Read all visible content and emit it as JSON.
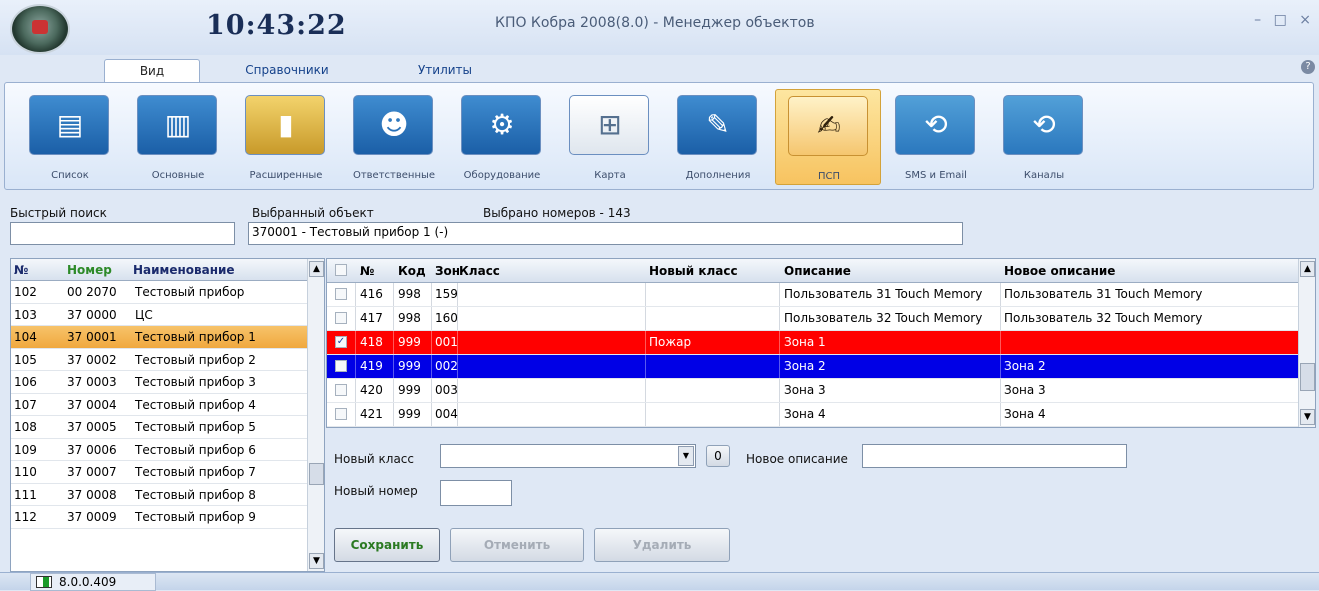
{
  "window": {
    "clock": "10:43:22",
    "title": "КПО Кобра 2008(8.0) -   Менеджер объектов",
    "controls": [
      "–",
      "□",
      "×"
    ]
  },
  "tabs": [
    {
      "label": "Вид",
      "active": true
    },
    {
      "label": "Справочники",
      "active": false
    },
    {
      "label": "Утилиты",
      "active": false
    }
  ],
  "ribbon": [
    {
      "label": "Список",
      "icon": "list-icon"
    },
    {
      "label": "Основные",
      "icon": "window-icon"
    },
    {
      "label": "Расширенные",
      "icon": "book-icon"
    },
    {
      "label": "Ответственные",
      "icon": "users-icon"
    },
    {
      "label": "Оборудование",
      "icon": "equipment-icon"
    },
    {
      "label": "Карта",
      "icon": "map-icon"
    },
    {
      "label": "Дополнения",
      "icon": "documents-icon"
    },
    {
      "label": "ПСП",
      "icon": "signature-icon"
    },
    {
      "label": "SMS и Email",
      "icon": "sms-icon"
    },
    {
      "label": "Каналы",
      "icon": "channels-icon"
    }
  ],
  "search": {
    "quick_label": "Быстрый поиск",
    "quick_value": "",
    "selected_label": "Выбранный объект",
    "selected_value": "370001 - Тестовый прибор 1 (-)",
    "count_label": "Выбрано номеров - 143"
  },
  "object_list": {
    "headers": {
      "no": "№",
      "number": "Номер",
      "name": "Наименование"
    },
    "rows": [
      {
        "no": "102",
        "number": "00 2070",
        "name": "Тестовый прибор",
        "selected": false
      },
      {
        "no": "103",
        "number": "37 0000",
        "name": "ЦС",
        "selected": false
      },
      {
        "no": "104",
        "number": "37 0001",
        "name": "Тестовый прибор 1",
        "selected": true
      },
      {
        "no": "105",
        "number": "37 0002",
        "name": "Тестовый прибор 2",
        "selected": false
      },
      {
        "no": "106",
        "number": "37 0003",
        "name": "Тестовый прибор 3",
        "selected": false
      },
      {
        "no": "107",
        "number": "37 0004",
        "name": "Тестовый прибор 4",
        "selected": false
      },
      {
        "no": "108",
        "number": "37 0005",
        "name": "Тестовый прибор 5",
        "selected": false
      },
      {
        "no": "109",
        "number": "37 0006",
        "name": "Тестовый прибор 6",
        "selected": false
      },
      {
        "no": "110",
        "number": "37 0007",
        "name": "Тестовый прибор 7",
        "selected": false
      },
      {
        "no": "111",
        "number": "37 0008",
        "name": "Тестовый прибор 8",
        "selected": false
      },
      {
        "no": "112",
        "number": "37 0009",
        "name": "Тестовый прибор 9",
        "selected": false
      }
    ]
  },
  "zones": {
    "headers": {
      "no": "№",
      "code": "Код",
      "zone": "Зона",
      "class": "Класс",
      "new_class": "Новый класс",
      "description": "Описание",
      "new_description": "Новое описание"
    },
    "rows": [
      {
        "checked": false,
        "no": "416",
        "code": "998",
        "zone": "159",
        "class": "",
        "new_class": "",
        "description": "Пользователь 31 Touch Memory",
        "new_description": "Пользователь 31 Touch Memory",
        "style": ""
      },
      {
        "checked": false,
        "no": "417",
        "code": "998",
        "zone": "160",
        "class": "",
        "new_class": "",
        "description": "Пользователь 32 Touch Memory",
        "new_description": "Пользователь 32 Touch Memory",
        "style": ""
      },
      {
        "checked": true,
        "no": "418",
        "code": "999",
        "zone": "001",
        "class": "",
        "new_class": "Пожар",
        "description": "Зона 1",
        "new_description": "",
        "style": "red"
      },
      {
        "checked": false,
        "no": "419",
        "code": "999",
        "zone": "002",
        "class": "",
        "new_class": "",
        "description": "Зона 2",
        "new_description": "Зона 2",
        "style": "blue"
      },
      {
        "checked": false,
        "no": "420",
        "code": "999",
        "zone": "003",
        "class": "",
        "new_class": "",
        "description": "Зона 3",
        "new_description": "Зона 3",
        "style": ""
      },
      {
        "checked": false,
        "no": "421",
        "code": "999",
        "zone": "004",
        "class": "",
        "new_class": "",
        "description": "Зона 4",
        "new_description": "Зона 4",
        "style": ""
      }
    ]
  },
  "form": {
    "new_class_label": "Новый класс",
    "new_class_value": "",
    "zero_button": "0",
    "new_desc_label": "Новое описание",
    "new_desc_value": "",
    "new_number_label": "Новый номер",
    "new_number_value": "",
    "save": "Сохранить",
    "cancel": "Отменить",
    "delete": "Удалить"
  },
  "status": {
    "version": "8.0.0.409"
  },
  "colors": {
    "selected_row": "#f0a83e",
    "alarm_row": "#ff0000",
    "focus_row": "#0000e6"
  }
}
